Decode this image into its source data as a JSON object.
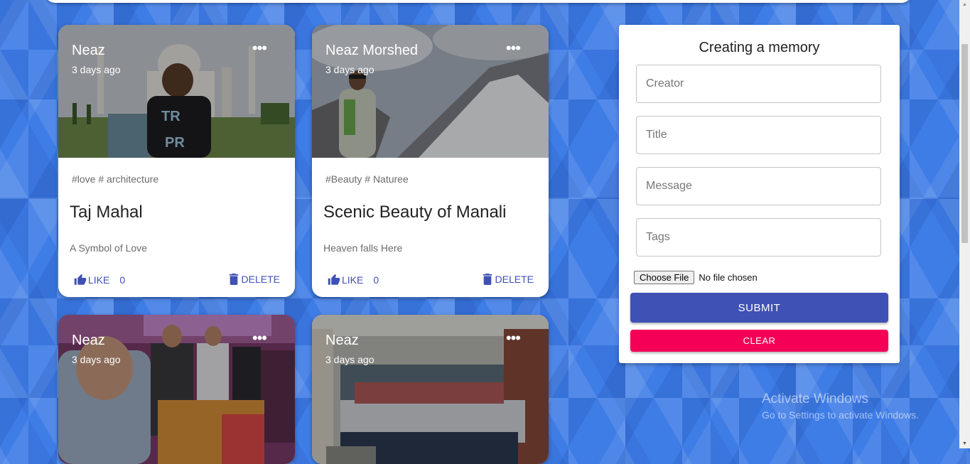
{
  "posts": [
    {
      "author": "Neaz",
      "time": "3 days ago",
      "tags": "#love # architecture",
      "title": "Taj Mahal",
      "message": "A Symbol of Love",
      "like_label": "LIKE",
      "likes": "0",
      "delete_label": "DELETE",
      "more": "•••"
    },
    {
      "author": "Neaz Morshed",
      "time": "3 days ago",
      "tags": "#Beauty # Naturee",
      "title": "Scenic Beauty of Manali",
      "message": "Heaven falls Here",
      "like_label": "LIKE",
      "likes": "0",
      "delete_label": "DELETE",
      "more": "•••"
    },
    {
      "author": "Neaz",
      "time": "3 days ago",
      "more": "•••"
    },
    {
      "author": "Neaz",
      "time": "3 days ago",
      "more": "•••"
    }
  ],
  "form": {
    "title": "Creating a memory",
    "creator_placeholder": "Creator",
    "title_placeholder": "Title",
    "message_placeholder": "Message",
    "tags_placeholder": "Tags",
    "choose_file_label": "Choose File",
    "file_status": "No file chosen",
    "submit_label": "SUBMIT",
    "clear_label": "CLEAR"
  },
  "watermark": {
    "line1": "Activate Windows",
    "line2": "Go to Settings to activate Windows."
  },
  "colors": {
    "primary": "#3f51b5",
    "secondary": "#f50057",
    "background": "#3f7de6"
  }
}
